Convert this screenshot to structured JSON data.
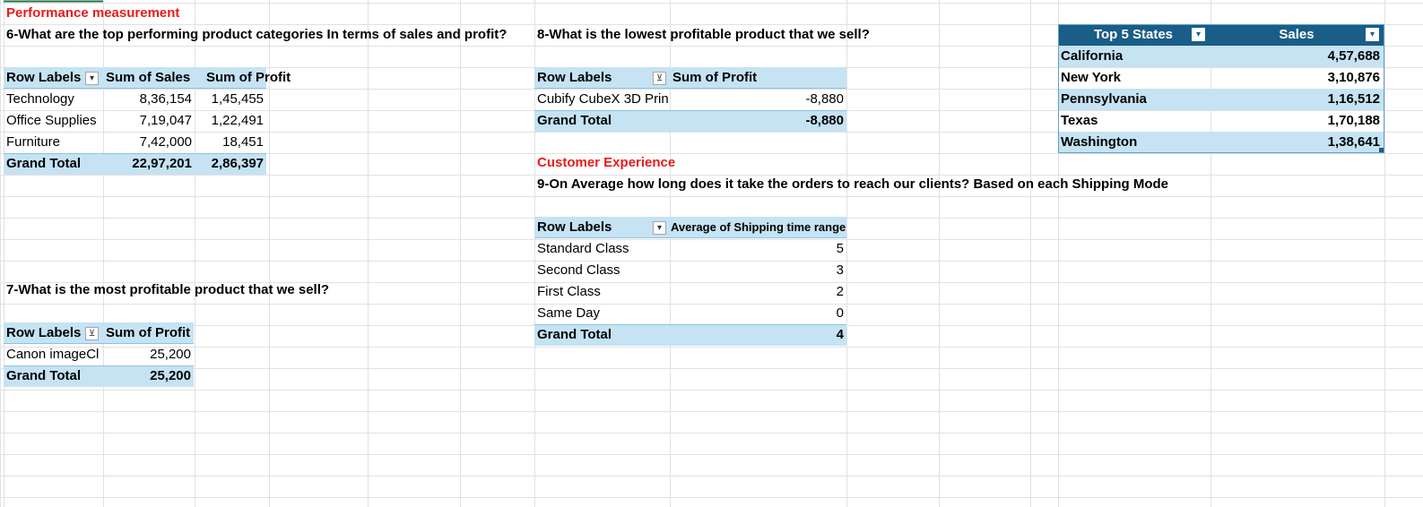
{
  "sheet": {
    "title_performance": "Performance measurement",
    "title_customer": "Customer Experience"
  },
  "q6": {
    "question": "6-What are the top performing product categories In terms of sales and profit?",
    "headers": [
      "Row Labels",
      "Sum of Sales",
      "Sum of Profit"
    ],
    "rows": [
      {
        "label": "Technology",
        "sales": "8,36,154",
        "profit": "1,45,455"
      },
      {
        "label": "Office Supplies",
        "sales": "7,19,047",
        "profit": "1,22,491"
      },
      {
        "label": "Furniture",
        "sales": "7,42,000",
        "profit": "18,451"
      }
    ],
    "total": {
      "label": "Grand Total",
      "sales": "22,97,201",
      "profit": "2,86,397"
    },
    "filter_icon": "sort-desc-icon"
  },
  "q7": {
    "question": "7-What is the most profitable product that we sell?",
    "headers": [
      "Row Labels",
      "Sum of Profit"
    ],
    "rows": [
      {
        "label": "Canon imageCl",
        "profit": "25,200"
      }
    ],
    "total": {
      "label": "Grand Total",
      "profit": "25,200"
    },
    "filter_icon": "filter-icon"
  },
  "q8": {
    "question": "8-What is the lowest profitable product that we sell?",
    "headers": [
      "Row Labels",
      "Sum of Profit"
    ],
    "rows": [
      {
        "label": "Cubify CubeX 3D Prin",
        "profit": "-8,880"
      }
    ],
    "total": {
      "label": "Grand Total",
      "profit": "-8,880"
    },
    "filter_icon": "filter-icon"
  },
  "q9": {
    "question": "9-On Average how long does it take the orders to reach our clients? Based on each Shipping Mode",
    "headers": [
      "Row Labels",
      "Average of Shipping time range"
    ],
    "rows": [
      {
        "label": "Standard Class",
        "value": "5"
      },
      {
        "label": "Second Class",
        "value": "3"
      },
      {
        "label": "First Class",
        "value": "2"
      },
      {
        "label": "Same Day",
        "value": "0"
      }
    ],
    "total": {
      "label": "Grand Total",
      "value": "4"
    },
    "filter_icon": "sort-desc-icon"
  },
  "top_states": {
    "headers": [
      "Top 5 States",
      "Sales"
    ],
    "rows": [
      {
        "state": "California",
        "sales": "4,57,688"
      },
      {
        "state": "New York",
        "sales": "3,10,876"
      },
      {
        "state": "Pennsylvania",
        "sales": "1,16,512"
      },
      {
        "state": "Texas",
        "sales": "1,70,188"
      },
      {
        "state": "Washington",
        "sales": "1,38,641"
      }
    ],
    "filter_icon": "dropdown-arrow-icon"
  },
  "colors": {
    "title_red": "#e81b1b",
    "pivot_band": "#c5e3f3",
    "table_header": "#1a5d86",
    "gridline": "#e1e1e1"
  }
}
